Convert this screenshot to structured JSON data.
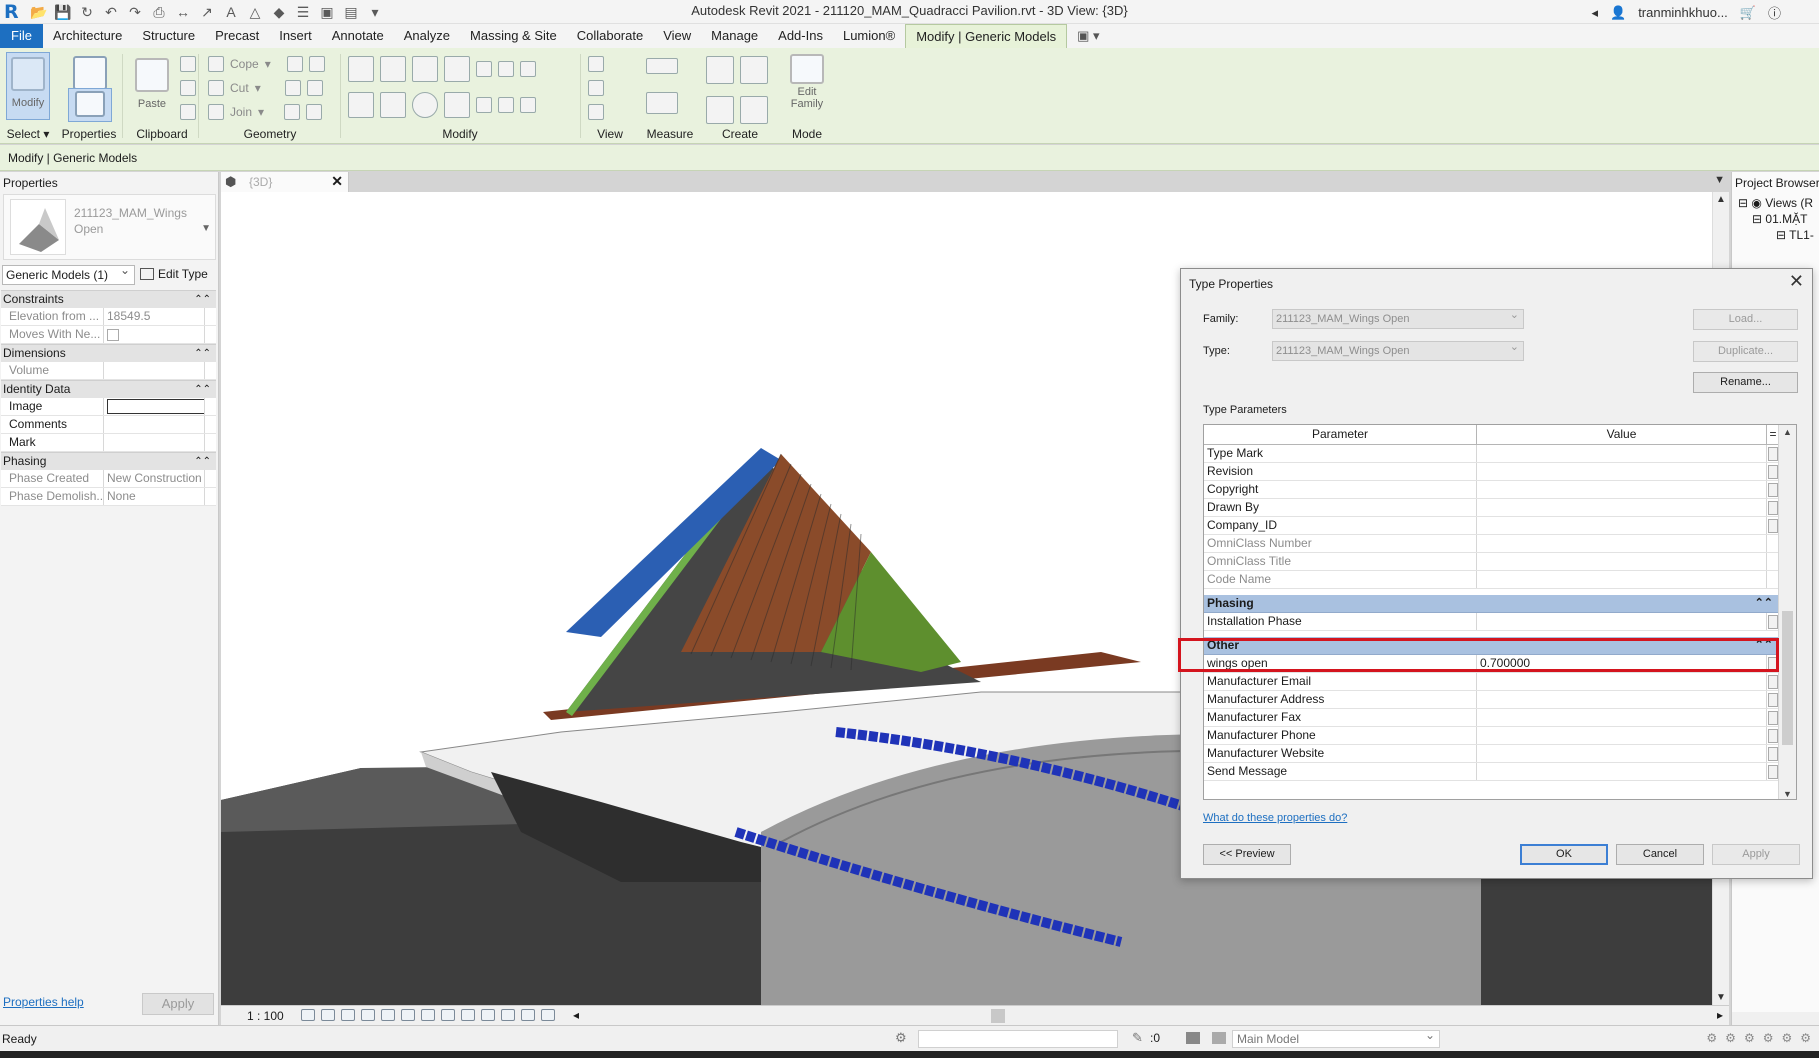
{
  "app": {
    "title": "Autodesk Revit 2021 - 211120_MAM_Quadracci Pavilion.rvt - 3D View: {3D}",
    "user": "tranminhkhuo...",
    "logo": "R"
  },
  "ribbon_tabs": [
    "File",
    "Architecture",
    "Structure",
    "Precast",
    "Insert",
    "Annotate",
    "Analyze",
    "Massing & Site",
    "Collaborate",
    "View",
    "Manage",
    "Add-Ins",
    "Lumion®",
    "Modify | Generic Models"
  ],
  "ribbon": {
    "modify_label": "Modify",
    "paste_label": "Paste",
    "copy_label": "Cope",
    "cut_label": "Cut",
    "join_label": "Join",
    "edit_family_label": "Edit Family",
    "groups": {
      "select": "Select",
      "properties": "Properties",
      "clipboard": "Clipboard",
      "geometry": "Geometry",
      "modify": "Modify",
      "view": "View",
      "measure": "Measure",
      "create": "Create",
      "mode": "Mode"
    }
  },
  "options_bar": {
    "context": "Modify | Generic Models"
  },
  "properties": {
    "title": "Properties",
    "type_name": "211123_MAM_Wings Open",
    "selector": "Generic Models (1)",
    "edit_type": "Edit Type",
    "categories": {
      "constraints": "Constraints",
      "dimensions": "Dimensions",
      "identity": "Identity Data",
      "phasing": "Phasing"
    },
    "rows": {
      "elevation": {
        "name": "Elevation from ...",
        "value": "18549.5"
      },
      "moves": {
        "name": "Moves With Ne..."
      },
      "volume": {
        "name": "Volume",
        "value": ""
      },
      "image": {
        "name": "Image"
      },
      "comments": {
        "name": "Comments",
        "value": ""
      },
      "mark": {
        "name": "Mark",
        "value": ""
      },
      "phase_created": {
        "name": "Phase Created",
        "value": "New Construction"
      },
      "phase_demolished": {
        "name": "Phase Demolish...",
        "value": "None"
      }
    },
    "help": "Properties help",
    "apply": "Apply"
  },
  "view": {
    "tab_label": "{3D}",
    "scale": "1 : 100"
  },
  "browser": {
    "title": "Project Browser",
    "nodes": [
      "Views (R",
      "01.MẶT",
      "TL1-"
    ]
  },
  "status": {
    "ready": "Ready",
    "zero": ":0",
    "model": "Main Model"
  },
  "dialog": {
    "title": "Type Properties",
    "family_label": "Family:",
    "family_value": "211123_MAM_Wings Open",
    "type_label": "Type:",
    "type_value": "211123_MAM_Wings Open",
    "load": "Load...",
    "duplicate": "Duplicate...",
    "rename": "Rename...",
    "type_parameters": "Type Parameters",
    "col_parameter": "Parameter",
    "col_value": "Value",
    "rows_top": [
      {
        "p": "Type Mark",
        "v": ""
      },
      {
        "p": "Revision",
        "v": ""
      },
      {
        "p": "Copyright",
        "v": ""
      },
      {
        "p": "Drawn By",
        "v": ""
      },
      {
        "p": "Company_ID",
        "v": ""
      },
      {
        "p": "OmniClass Number",
        "v": ""
      },
      {
        "p": "OmniClass Title",
        "v": ""
      },
      {
        "p": "Code Name",
        "v": ""
      }
    ],
    "cat_phasing": "Phasing",
    "installation_phase": "Installation Phase",
    "cat_other": "Other",
    "wings_open": {
      "p": "wings open",
      "v": "0.700000"
    },
    "rows_bottom": [
      {
        "p": "Manufacturer Email",
        "v": ""
      },
      {
        "p": "Manufacturer Address",
        "v": ""
      },
      {
        "p": "Manufacturer Fax",
        "v": ""
      },
      {
        "p": "Manufacturer Phone",
        "v": ""
      },
      {
        "p": "Manufacturer Website",
        "v": ""
      },
      {
        "p": "Send Message",
        "v": ""
      }
    ],
    "help": "What do these properties do?",
    "preview": "<< Preview",
    "ok": "OK",
    "cancel": "Cancel",
    "apply": "Apply"
  },
  "colors": {
    "accent": "#1d6fc1",
    "ribbon_bg": "#e9f2de",
    "category_blue": "#a9c1e0",
    "highlight_red": "#d4141e",
    "roof_blue": "#2b5fb3",
    "roof_brown": "#8a4b2a",
    "roof_green": "#5e8f2e",
    "fin_bar_blue": "#1f33b8"
  }
}
